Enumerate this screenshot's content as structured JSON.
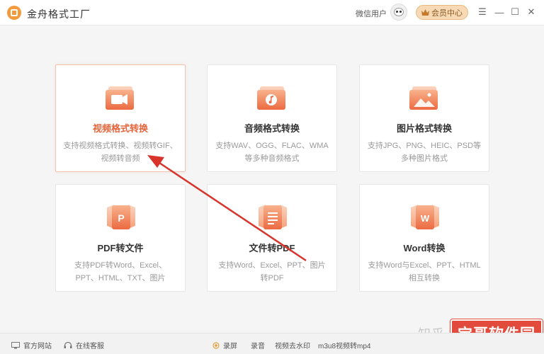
{
  "app": {
    "title": "金舟格式工厂",
    "user_name": "微信用户",
    "vip_label": "会员中心"
  },
  "window_controls": {
    "menu": "☰",
    "minimize": "—",
    "maximize": "☐",
    "close": "✕"
  },
  "cards": [
    {
      "title": "视频格式转换",
      "desc": "支持视频格式转换、视频转GIF、视频转音频",
      "icon": "video-icon",
      "active": true
    },
    {
      "title": "音频格式转换",
      "desc": "支持WAV、OGG、FLAC、WMA等多种音频格式",
      "icon": "music-icon",
      "active": false
    },
    {
      "title": "图片格式转换",
      "desc": "支持JPG、PNG、HEIC、PSD等多种图片格式",
      "icon": "image-icon",
      "active": false
    },
    {
      "title": "PDF转文件",
      "desc": "支持PDF转Word、Excel、PPT、HTML、TXT、图片",
      "icon": "pdf-icon",
      "active": false
    },
    {
      "title": "文件转PDF",
      "desc": "支持Word、Excel、PPT、图片转PDF",
      "icon": "document-icon",
      "active": false
    },
    {
      "title": "Word转换",
      "desc": "支持Word与Excel、PPT、HTML相互转换",
      "icon": "word-icon",
      "active": false
    }
  ],
  "footer": {
    "website": "官方网站",
    "support": "在线客服",
    "record_screen": "录屏",
    "record_audio": "录音",
    "remove_watermark": "视频去水印",
    "m3u8": "m3u8视频转mp4"
  },
  "watermark": {
    "zhihu": "知乎",
    "site": "宝哥软件园"
  },
  "colors": {
    "accent": "#e8643a",
    "icon_gradient_top": "#f8b28c",
    "icon_gradient_bottom": "#ec6a42",
    "vip_bg": "#f7d9b5",
    "arrow": "#d9342b"
  }
}
